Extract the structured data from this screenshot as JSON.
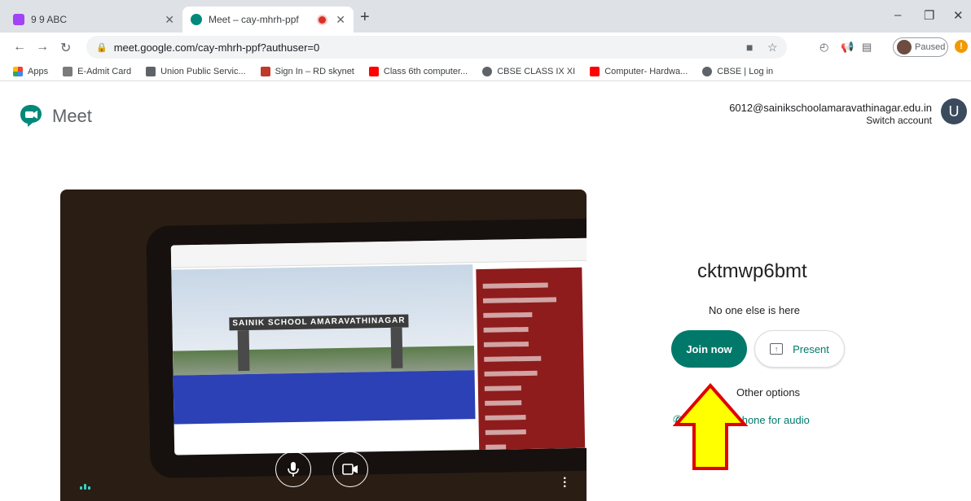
{
  "browser": {
    "tabs": [
      {
        "title": "9 9 ABC",
        "favicon_color": "#a142f4"
      },
      {
        "title": "Meet – cay-mhrh-ppf",
        "favicon_color": "#00897b"
      }
    ],
    "url": "meet.google.com/cay-mhrh-ppf?authuser=0",
    "profile_label": "Paused",
    "warning_glyph": "!",
    "bookmarks": [
      {
        "label": "Apps",
        "color": "#ea4335"
      },
      {
        "label": "E-Admit Card",
        "color": "#7b7b7b"
      },
      {
        "label": "Union Public Servic...",
        "color": "#5f6368"
      },
      {
        "label": "Sign In – RD skynet",
        "color": "#c0392b"
      },
      {
        "label": "Class 6th computer...",
        "color": "#ff0000"
      },
      {
        "label": "CBSE CLASS IX XI",
        "color": "#5f6368"
      },
      {
        "label": "Computer- Hardwa...",
        "color": "#ff0000"
      },
      {
        "label": "CBSE | Log in",
        "color": "#5f6368"
      }
    ]
  },
  "header": {
    "app_name": "Meet",
    "account_email": "6012@sainikschoolamaravathinagar.edu.in",
    "switch_account": "Switch account",
    "avatar_letter": "U"
  },
  "preview": {
    "gate_text": "SAINIK SCHOOL AMARAVATHINAGAR"
  },
  "join_panel": {
    "room_code": "cktmwp6bmt",
    "status": "No one else is here",
    "join_label": "Join now",
    "present_label": "Present",
    "other_options": "Other options",
    "phone_audio_prefix": "J",
    "phone_audio_label": "d use a phone for audio"
  },
  "colors": {
    "meet_green": "#00796b",
    "arrow_fill": "#ffff00",
    "arrow_stroke": "#e00000"
  }
}
